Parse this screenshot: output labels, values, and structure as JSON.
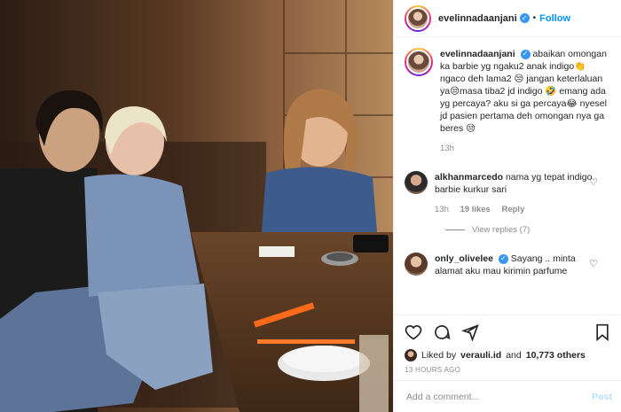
{
  "post": {
    "username": "evelinnadaanjani",
    "follow_label": "Follow",
    "separator": "•"
  },
  "caption": {
    "username": "evelinnadaanjani",
    "text": "abaikan omongan ka barbie yg ngaku2 anak indigo👏 ngaco deh lama2 😒 jangan keterlaluan ya😒masa tiba2 jd indigo 🤣 emang ada yg percaya? aku si ga percaya😂 nyesel jd pasien pertama deh omongan nya ga beres 😒",
    "time": "13h"
  },
  "comments": [
    {
      "username": "alkhanmarcedo",
      "text": "nama yg tepat indigo barbie kurkur sari",
      "time": "13h",
      "likes": "19 likes",
      "reply_label": "Reply",
      "view_replies": "View replies (7)"
    },
    {
      "username": "only_olivelee",
      "text": "Sayang .. minta alamat aku mau kirimin parfume"
    }
  ],
  "likes_line": {
    "prefix": "Liked by",
    "user": "verauli.id",
    "joiner": "and",
    "others": "10,773 others"
  },
  "timestamp": "13 HOURS AGO",
  "add_comment": {
    "placeholder": "Add a comment...",
    "post_label": "Post"
  },
  "icons": [
    "heart-icon",
    "comment-icon",
    "share-icon",
    "bookmark-icon",
    "verified-badge-icon"
  ],
  "colors": {
    "accent": "#0095f6",
    "verified": "#3897f0",
    "muted": "#8e8e8e"
  }
}
